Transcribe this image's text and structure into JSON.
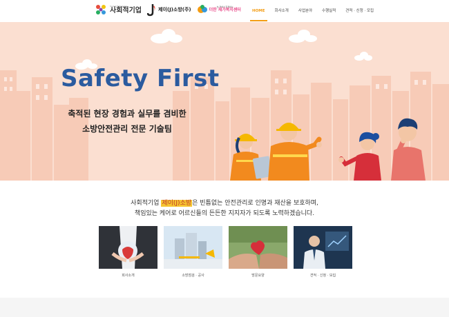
{
  "header": {
    "logo1": {
      "small": "Social Enterprise",
      "big": "사회적기업"
    },
    "logo2": {
      "text": "제이(J)소방(주)"
    },
    "logo3": {
      "small": "늘 곁에서 함께하는",
      "big": "더한 재가복지센터"
    }
  },
  "nav": [
    {
      "label": "HOME",
      "active": true
    },
    {
      "label": "회사소개",
      "active": false
    },
    {
      "label": "사업분야",
      "active": false
    },
    {
      "label": "수행실적",
      "active": false
    },
    {
      "label": "견적 · 신청 · 모집",
      "active": false
    }
  ],
  "hero": {
    "title": "Safety First",
    "line1": "축적된 현장 경험과 실무를 겸비한",
    "line2": "소방안전관리 전문 기술팀"
  },
  "intro": {
    "pre": "사회적기업 ",
    "highlight": "제이(J)소방",
    "post": "은 빈틈없는 안전관리로 인명과 재산을 보호하며,",
    "line2": "책임있는 케어로 어르신들의 든든한 지지자가 되도록 노력하겠습니다."
  },
  "cards": [
    {
      "label": "회사소개"
    },
    {
      "label": "소방점검 · 공사"
    },
    {
      "label": "방문요양"
    },
    {
      "label": "견적 · 신청 · 모집"
    }
  ],
  "colors": {
    "accent": "#f39c12",
    "hero_bg": "#fbdfd1",
    "title_blue": "#2b5b9f",
    "highlight": "#f5c531"
  }
}
